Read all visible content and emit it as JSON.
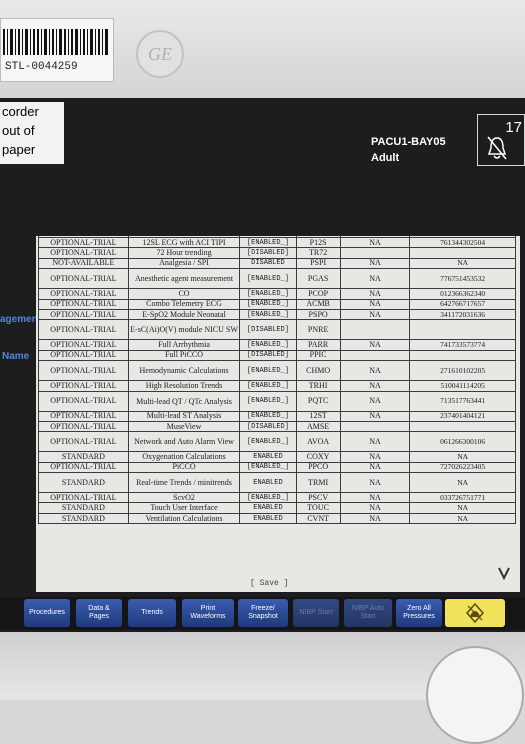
{
  "device": {
    "asset_tag": "STL-0044259",
    "logo": "GE"
  },
  "header": {
    "left_lines": [
      "corder",
      "out of",
      "paper"
    ],
    "bed_label": "PACU1-BAY05",
    "patient_type": "Adult",
    "alarm_number": "17",
    "alarm_icon": "alarm-off-bell-icon"
  },
  "side_labels": {
    "management": "agement",
    "name": "Name"
  },
  "config_table": {
    "rows": [
      [
        "OPTIONAL-TRIAL",
        "12SL ECG with ACI TIPI",
        "[ENABLED_]",
        "P12S",
        "NA",
        "761344302504"
      ],
      [
        "OPTIONAL-TRIAL",
        "72 Hour trending",
        "[DISABLED]",
        "TR72",
        "",
        ""
      ],
      [
        "NOT-AVAILABLE",
        "Analgesia / SPI",
        "DISABLED",
        "PSPI",
        "NA",
        "NA"
      ],
      [
        "OPTIONAL-TRIAL",
        "Anesthetic agent measurement",
        "[ENABLED_]",
        "PGAS",
        "NA",
        "776751453532"
      ],
      [
        "OPTIONAL-TRIAL",
        "CO",
        "[ENABLED_]",
        "PCOP",
        "NA",
        "012366362340"
      ],
      [
        "OPTIONAL-TRIAL",
        "Combo Telemetry ECG",
        "[ENABLED_]",
        "ACMB",
        "NA",
        "642766717657"
      ],
      [
        "OPTIONAL-TRIAL",
        "E-SpO2 Module Neonatal",
        "[ENABLED_]",
        "PSPO",
        "NA",
        "341172031636"
      ],
      [
        "OPTIONAL-TRIAL",
        "E-sC(Ai)O(V) module NICU SW",
        "[DISABLED]",
        "PNRE",
        "",
        ""
      ],
      [
        "OPTIONAL-TRIAL",
        "Full Arrhythmia",
        "[ENABLED_]",
        "PARR",
        "NA",
        "741733573774"
      ],
      [
        "OPTIONAL-TRIAL",
        "Full PiCCO",
        "[DISABLED]",
        "PPIC",
        "",
        ""
      ],
      [
        "OPTIONAL-TRIAL",
        "Hemodynamic Calculations",
        "[ENABLED_]",
        "CHMO",
        "NA",
        "271610102205"
      ],
      [
        "OPTIONAL-TRIAL",
        "High Resolution Trends",
        "[ENABLED_]",
        "TRHI",
        "NA",
        "510041114205"
      ],
      [
        "OPTIONAL-TRIAL",
        "Multi-lead QT / QTc Analysis",
        "[ENABLED_]",
        "PQTC",
        "NA",
        "713517763441"
      ],
      [
        "OPTIONAL-TRIAL",
        "Multi-lead ST Analysis",
        "[ENABLED_]",
        "12ST",
        "NA",
        "237401404121"
      ],
      [
        "OPTIONAL-TRIAL",
        "MuseView",
        "[DISABLED]",
        "AMSE",
        "",
        ""
      ],
      [
        "OPTIONAL-TRIAL",
        "Network and Auto Alarm View",
        "[ENABLED_]",
        "AVOA",
        "NA",
        "061266300106"
      ],
      [
        "STANDARD",
        "Oxygenation Calculations",
        "ENABLED",
        "COXY",
        "NA",
        "NA"
      ],
      [
        "OPTIONAL-TRIAL",
        "PiCCO",
        "[ENABLED_]",
        "PPCO",
        "NA",
        "727026223405"
      ],
      [
        "STANDARD",
        "Real-time Trends / minitrends",
        "ENABLED",
        "TRMI",
        "NA",
        "NA"
      ],
      [
        "OPTIONAL-TRIAL",
        "ScvO2",
        "[ENABLED_]",
        "PSCV",
        "NA",
        "033726751771"
      ],
      [
        "STANDARD",
        "Touch User Interface",
        "ENABLED",
        "TOUC",
        "NA",
        "NA"
      ],
      [
        "STANDARD",
        "Ventilation Calculations",
        "ENABLED",
        "CVNT",
        "NA",
        "NA"
      ]
    ],
    "save_label": "[ Save ]"
  },
  "menu": {
    "procedures": "Procedures",
    "data_pages": "Data & Pages",
    "trends": "Trends",
    "print_waveforms": "Print Waveforms",
    "freeze_snapshot": "Freeze/ Snapshot",
    "nibp_start": "NIBP Start",
    "nibp_auto_start": "NIBP Auto Start",
    "zero_all_pressures": "Zero All Pressures"
  },
  "colors": {
    "menu_button": "#2c4a94",
    "alarm_silence": "#f2e15a",
    "side_label": "#4e88d8",
    "panel": "#e7e7e3"
  }
}
